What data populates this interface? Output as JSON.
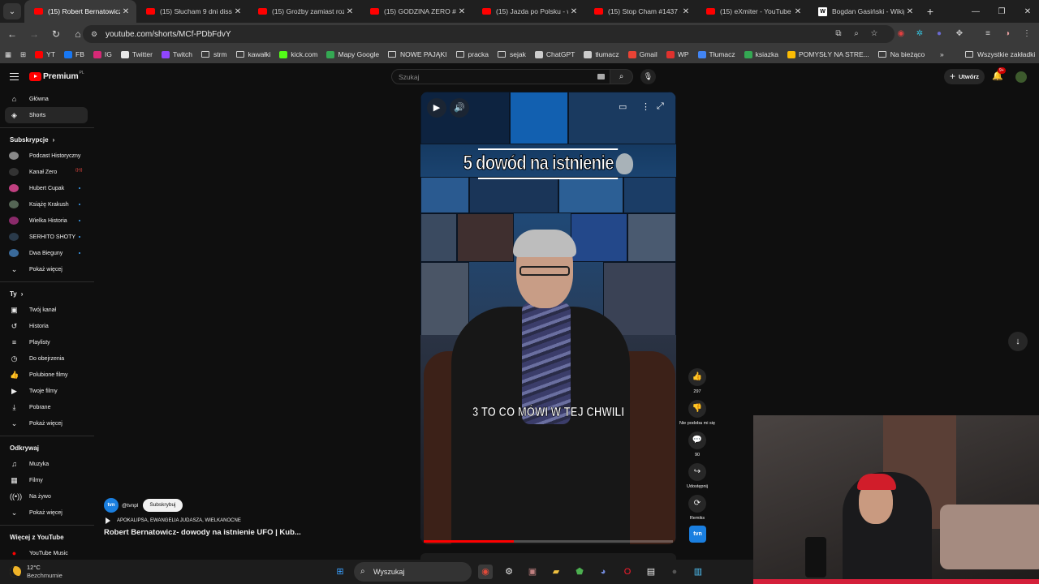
{
  "browser": {
    "tabs": [
      {
        "title": "(15) Robert Bernatowicz-",
        "icon": "youtube-icon",
        "active": true
      },
      {
        "title": "(15) Słucham 9 dni dissu",
        "icon": "youtube-icon"
      },
      {
        "title": "(15) Groźby zamiast rozm",
        "icon": "youtube-icon"
      },
      {
        "title": "(15) GODZINA ZERO #18:",
        "icon": "youtube-icon"
      },
      {
        "title": "(15) Jazda po Polsku - wy",
        "icon": "youtube-icon"
      },
      {
        "title": "(15) Stop Cham #1437 - I",
        "icon": "youtube-icon"
      },
      {
        "title": "(15) eXmiter - YouTube",
        "icon": "youtube-icon"
      },
      {
        "title": "Bogdan Gasiński - Wikipe",
        "icon": "wikipedia-icon"
      }
    ],
    "url": "youtube.com/shorts/MCf-PDbFdvY",
    "bookmarks": [
      {
        "label": "YT",
        "color": "#ff0000"
      },
      {
        "label": "FB",
        "color": "#1877f2"
      },
      {
        "label": "IG",
        "color": "#d62976"
      },
      {
        "label": "Twitter",
        "color": "#e7e7e7"
      },
      {
        "label": "Twitch",
        "color": "#9146ff"
      },
      {
        "label": "strm",
        "folder": true
      },
      {
        "label": "kawałki",
        "folder": true
      },
      {
        "label": "kick.com",
        "color": "#53fc18"
      },
      {
        "label": "Mapy Google",
        "color": "#34a853"
      },
      {
        "label": "NOWE PAJĄKI",
        "folder": true
      },
      {
        "label": "pracka",
        "folder": true
      },
      {
        "label": "sejak",
        "folder": true
      },
      {
        "label": "ChatGPT",
        "color": "#cccccc"
      },
      {
        "label": "tłumacz",
        "color": "#cccccc"
      },
      {
        "label": "Gmail",
        "color": "#ea4335"
      },
      {
        "label": "WP",
        "color": "#e0322e"
      },
      {
        "label": "Tłumacz",
        "color": "#4285f4"
      },
      {
        "label": "ksiazka",
        "color": "#34a853"
      },
      {
        "label": "POMYSŁY NA STRE...",
        "color": "#fbbc04"
      },
      {
        "label": "Na bieżąco",
        "folder": true
      }
    ],
    "all_bookmarks": "Wszystkie zakładki"
  },
  "youtube": {
    "logo_text": "Premium",
    "logo_sup": "PL",
    "search_placeholder": "Szukaj",
    "create_label": "Utwórz",
    "notif_badge": "9+",
    "sidebar": {
      "main": [
        {
          "label": "Główna",
          "icon": "home-icon"
        },
        {
          "label": "Shorts",
          "icon": "shorts-icon",
          "active": true
        }
      ],
      "subs_header": "Subskrypcje",
      "subs": [
        {
          "label": "Podcast Historyczny",
          "color": "#888888"
        },
        {
          "label": "Kanał Zero",
          "color": "#333333",
          "live": true
        },
        {
          "label": "Hubert Cupak",
          "color": "#c04080",
          "dot": true
        },
        {
          "label": "Książę Krakush",
          "color": "#556655",
          "dot": true
        },
        {
          "label": "Wielka Historia",
          "color": "#8a2a6a",
          "dot": true
        },
        {
          "label": "SERHITO SHOTY",
          "color": "#2a3a4a",
          "dot": true
        },
        {
          "label": "Dwa Bieguny",
          "color": "#3a6a9a",
          "dot": true
        },
        {
          "label": "Pokaż więcej",
          "icon": "chevron-down-icon"
        }
      ],
      "you_header": "Ty",
      "you": [
        {
          "label": "Twój kanał",
          "icon": "channel-icon"
        },
        {
          "label": "Historia",
          "icon": "history-icon"
        },
        {
          "label": "Playlisty",
          "icon": "playlists-icon"
        },
        {
          "label": "Do obejrzenia",
          "icon": "watch-later-icon"
        },
        {
          "label": "Polubione filmy",
          "icon": "liked-icon"
        },
        {
          "label": "Twoje filmy",
          "icon": "your-videos-icon"
        },
        {
          "label": "Pobrane",
          "icon": "download-icon"
        },
        {
          "label": "Pokaż więcej",
          "icon": "chevron-down-icon"
        }
      ],
      "explore_header": "Odkrywaj",
      "explore": [
        {
          "label": "Muzyka",
          "icon": "music-icon"
        },
        {
          "label": "Filmy",
          "icon": "movies-icon"
        },
        {
          "label": "Na żywo",
          "icon": "live-icon"
        },
        {
          "label": "Pokaż więcej",
          "icon": "chevron-down-icon"
        }
      ],
      "more_header": "Więcej z YouTube",
      "more": [
        {
          "label": "YouTube Music",
          "icon": "youtube-music-icon"
        }
      ]
    },
    "short": {
      "overlay_title": "5 dowód na istnienie",
      "caption": "3 TO CO MÓWI W TEJ CHWILI",
      "progress_fraction": 0.36,
      "likes": "297",
      "dislike_label": "Nie podoba mi się",
      "comments": "90",
      "share_label": "Udostępnij",
      "remix_label": "Remiks",
      "channel_logo": "tvn",
      "channel_handle": "@tvnpl",
      "subscribe_label": "Subskrybuj",
      "tags": "APOKALIPSA, EWANGELIA JUDASZA, WIELKANOCNE",
      "video_title": "Robert Bernatowicz- dowody na istnienie UFO | Kub..."
    }
  },
  "taskbar": {
    "temp": "12°C",
    "weather": "Bezchmurnie",
    "search": "Wyszukaj"
  }
}
